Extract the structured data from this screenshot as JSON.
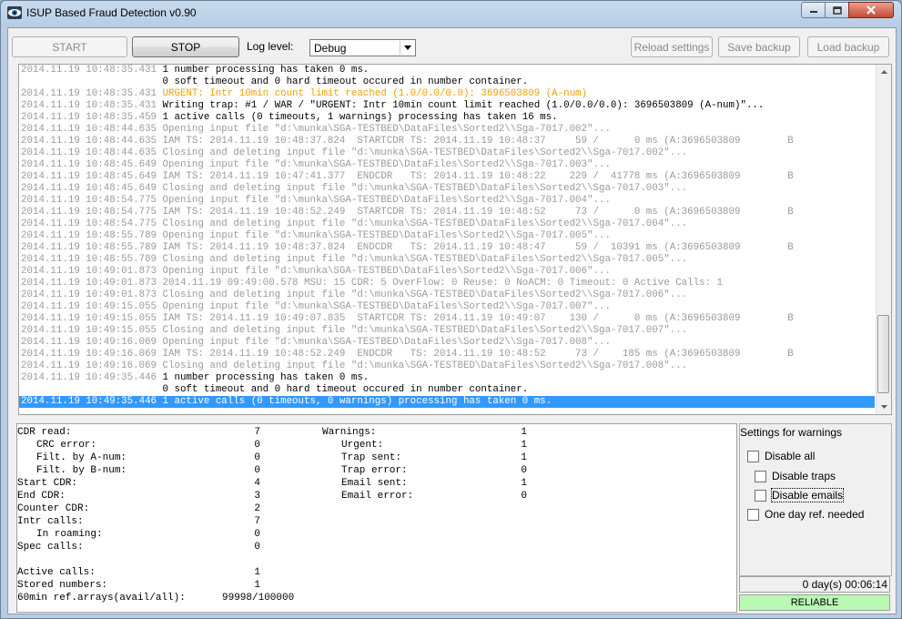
{
  "window": {
    "title": "ISUP Based Fraud Detection v0.90"
  },
  "toolbar": {
    "start_label": "START",
    "stop_label": "STOP",
    "log_level_label": "Log level:",
    "log_level_value": "Debug",
    "reload_label": "Reload settings",
    "save_backup_label": "Save backup",
    "load_backup_label": "Load backup"
  },
  "log": {
    "lines": [
      {
        "text": "2014.11.19 10:48:35.431 1 number processing has taken 0 ms.",
        "color": "mixed-black"
      },
      {
        "text": "                        0 soft timeout and 0 hard timeout occured in number container.",
        "color": "black"
      },
      {
        "text": "2014.11.19 10:48:35.431 URGENT: Intr 10min count limit reached (1.0/0.0/0.0): 3696503809 (A-num)",
        "color": "mixed-orange"
      },
      {
        "text": "2014.11.19 10:48:35.431 Writing trap: #1 / WAR / \"URGENT: Intr 10min count limit reached (1.0/0.0/0.0): 3696503809 (A-num)\"...",
        "color": "mixed-black"
      },
      {
        "text": "2014.11.19 10:48:35.459 1 active calls (0 timeouts, 1 warnings) processing has taken 16 ms.",
        "color": "mixed-black"
      },
      {
        "text": "2014.11.19 10:48:44.635 Opening input file \"d:\\munka\\SGA-TESTBED\\DataFiles\\Sorted2\\\\Sga-7017.002\"...",
        "color": "grey"
      },
      {
        "text": "2014.11.19 10:48:44.635 IAM TS: 2014.11.19 10:48:37.824  STARTCDR TS: 2014.11.19 10:48:37     59 /      0 ms (A:3696503809        B",
        "color": "grey"
      },
      {
        "text": "2014.11.19 10:48:44.635 Closing and deleting input file \"d:\\munka\\SGA-TESTBED\\DataFiles\\Sorted2\\\\Sga-7017.002\"...",
        "color": "grey"
      },
      {
        "text": "2014.11.19 10:48:45.649 Opening input file \"d:\\munka\\SGA-TESTBED\\DataFiles\\Sorted2\\\\Sga-7017.003\"...",
        "color": "grey"
      },
      {
        "text": "2014.11.19 10:48:45.649 IAM TS: 2014.11.19 10:47:41.377  ENDCDR   TS: 2014.11.19 10:48:22    229 /  41778 ms (A:3696503809        B",
        "color": "grey"
      },
      {
        "text": "2014.11.19 10:48:45.649 Closing and deleting input file \"d:\\munka\\SGA-TESTBED\\DataFiles\\Sorted2\\\\Sga-7017.003\"...",
        "color": "grey"
      },
      {
        "text": "2014.11.19 10:48:54.775 Opening input file \"d:\\munka\\SGA-TESTBED\\DataFiles\\Sorted2\\\\Sga-7017.004\"...",
        "color": "grey"
      },
      {
        "text": "2014.11.19 10:48:54.775 IAM TS: 2014.11.19 10:48:52.249  STARTCDR TS: 2014.11.19 10:48:52     73 /      0 ms (A:3696503809        B",
        "color": "grey"
      },
      {
        "text": "2014.11.19 10:48:54.775 Closing and deleting input file \"d:\\munka\\SGA-TESTBED\\DataFiles\\Sorted2\\\\Sga-7017.004\"...",
        "color": "grey"
      },
      {
        "text": "2014.11.19 10:48:55.789 Opening input file \"d:\\munka\\SGA-TESTBED\\DataFiles\\Sorted2\\\\Sga-7017.005\"...",
        "color": "grey"
      },
      {
        "text": "2014.11.19 10:48:55.789 IAM TS: 2014.11.19 10:48:37.824  ENDCDR   TS: 2014.11.19 10:48:47     59 /  10391 ms (A:3696503809        B",
        "color": "grey"
      },
      {
        "text": "2014.11.19 10:48:55.789 Closing and deleting input file \"d:\\munka\\SGA-TESTBED\\DataFiles\\Sorted2\\\\Sga-7017.005\"...",
        "color": "grey"
      },
      {
        "text": "2014.11.19 10:49:01.873 Opening input file \"d:\\munka\\SGA-TESTBED\\DataFiles\\Sorted2\\\\Sga-7017.006\"...",
        "color": "grey"
      },
      {
        "text": "2014.11.19 10:49:01.873 2014.11.19 09:49:00.578 MSU: 15 CDR: 5 OverFlow: 0 Reuse: 0 NoACM: 0 Timeout: 0 Active Calls: 1",
        "color": "grey"
      },
      {
        "text": "2014.11.19 10:49:01.873 Closing and deleting input file \"d:\\munka\\SGA-TESTBED\\DataFiles\\Sorted2\\\\Sga-7017.006\"...",
        "color": "grey"
      },
      {
        "text": "2014.11.19 10:49:15.055 Opening input file \"d:\\munka\\SGA-TESTBED\\DataFiles\\Sorted2\\\\Sga-7017.007\"...",
        "color": "grey"
      },
      {
        "text": "2014.11.19 10:49:15.055 IAM TS: 2014.11.19 10:49:07.835  STARTCDR TS: 2014.11.19 10:49:07    130 /      0 ms (A:3696503809        B",
        "color": "grey"
      },
      {
        "text": "2014.11.19 10:49:15.055 Closing and deleting input file \"d:\\munka\\SGA-TESTBED\\DataFiles\\Sorted2\\\\Sga-7017.007\"...",
        "color": "grey"
      },
      {
        "text": "2014.11.19 10:49:16.069 Opening input file \"d:\\munka\\SGA-TESTBED\\DataFiles\\Sorted2\\\\Sga-7017.008\"...",
        "color": "grey"
      },
      {
        "text": "2014.11.19 10:49:16.069 IAM TS: 2014.11.19 10:48:52.249  ENDCDR   TS: 2014.11.19 10:48:52     73 /    185 ms (A:3696503809        B",
        "color": "grey"
      },
      {
        "text": "2014.11.19 10:49:16.069 Closing and deleting input file \"d:\\munka\\SGA-TESTBED\\DataFiles\\Sorted2\\\\Sga-7017.008\"...",
        "color": "grey"
      },
      {
        "text": "2014.11.19 10:49:35.446 1 number processing has taken 0 ms.",
        "color": "mixed-black"
      },
      {
        "text": "                        0 soft timeout and 0 hard timeout occured in number container.",
        "color": "black"
      },
      {
        "text": "2014.11.19 10:49:35.446 1 active calls (0 timeouts, 0 warnings) processing has taken 0 ms.",
        "color": "selected"
      }
    ]
  },
  "stats": {
    "left": [
      {
        "label": "CDR read:",
        "value": "7",
        "indent": 0
      },
      {
        "label": "CRC error:",
        "value": "0",
        "indent": 1
      },
      {
        "label": "Filt. by A-num:",
        "value": "0",
        "indent": 1
      },
      {
        "label": "Filt. by B-num:",
        "value": "0",
        "indent": 1
      },
      {
        "label": "Start CDR:",
        "value": "4",
        "indent": 0
      },
      {
        "label": "End CDR:",
        "value": "3",
        "indent": 0
      },
      {
        "label": "Counter CDR:",
        "value": "2",
        "indent": 0
      },
      {
        "label": "Intr calls:",
        "value": "7",
        "indent": 0
      },
      {
        "label": "In roaming:",
        "value": "0",
        "indent": 1
      },
      {
        "label": "Spec calls:",
        "value": "0",
        "indent": 0
      },
      {
        "label": "",
        "value": "",
        "indent": 0
      },
      {
        "label": "Active calls:",
        "value": "1",
        "indent": 0
      },
      {
        "label": "Stored numbers:",
        "value": "1",
        "indent": 0
      }
    ],
    "ref_arrays_label": "60min ref.arrays(avail/all):",
    "ref_arrays_value": "99998/100000",
    "right": [
      {
        "label": "Warnings:",
        "value": "1",
        "indent": 0
      },
      {
        "label": "Urgent:",
        "value": "1",
        "indent": 1
      },
      {
        "label": "Trap sent:",
        "value": "1",
        "indent": 1
      },
      {
        "label": "Trap error:",
        "value": "0",
        "indent": 1
      },
      {
        "label": "Email sent:",
        "value": "1",
        "indent": 1
      },
      {
        "label": "Email error:",
        "value": "0",
        "indent": 1
      }
    ]
  },
  "settings": {
    "title": "Settings for warnings",
    "disable_all": "Disable all",
    "disable_traps": "Disable traps",
    "disable_emails": "Disable emails",
    "one_day_ref": "One day ref. needed"
  },
  "status": {
    "uptime": "0 day(s) 00:06:14",
    "state": "RELIABLE"
  }
}
